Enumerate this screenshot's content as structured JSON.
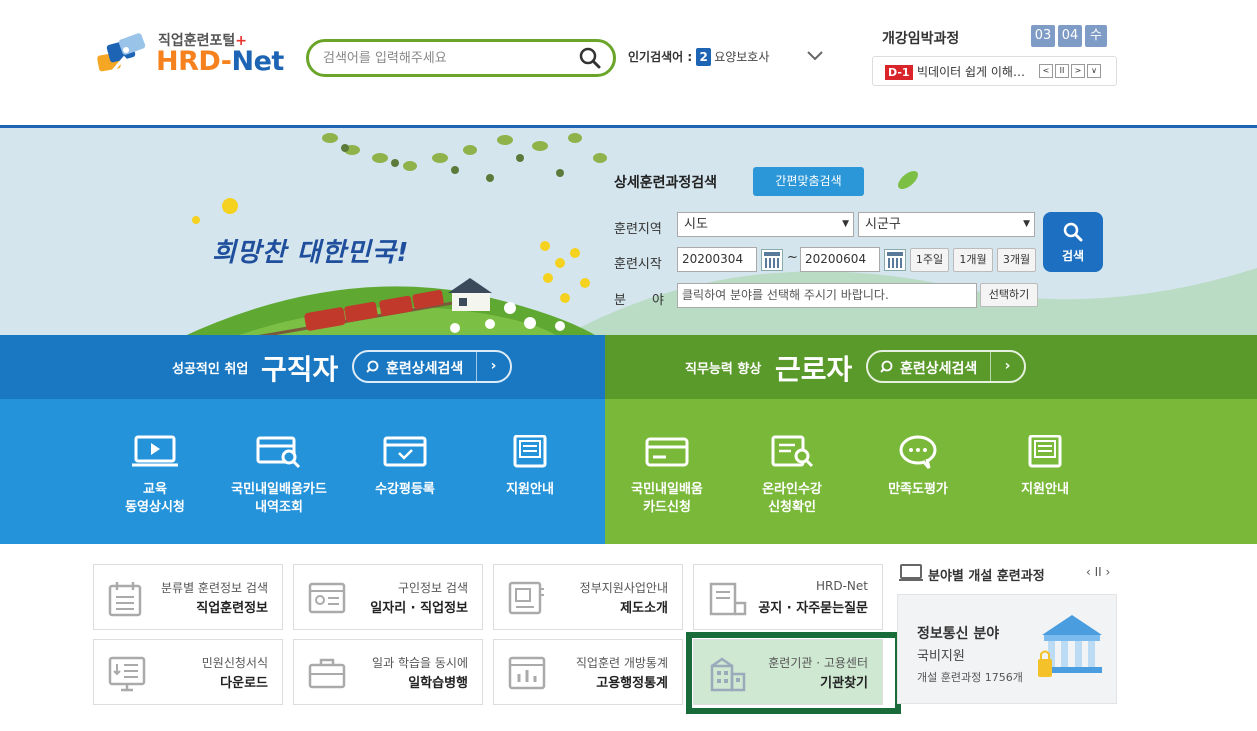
{
  "header": {
    "logo_small": "직업훈련포털",
    "logo_plus": "+",
    "logo_hrd": "HRD-",
    "logo_net": "Net",
    "search_placeholder": "검색어를 입력해주세요",
    "popular_label": "인기검색어 :",
    "popular_rank": "2",
    "popular_term": "요양보호사",
    "imminent_title": "개강임박과정",
    "date_month": "03",
    "date_day": "04",
    "date_weekday": "수",
    "dday": "D-1",
    "imminent_course": "빅데이터 쉽게 이해하기",
    "ctrl_prev": "<",
    "ctrl_pause": "II",
    "ctrl_next": ">",
    "ctrl_down": "∨"
  },
  "banner": {
    "slogan": "희망찬 대한민국!",
    "detail_title": "상세훈련과정검색",
    "simple_search": "간편맞춤검색",
    "label_region": "훈련지역",
    "select_sido": "시도",
    "select_sigungu": "시군구",
    "label_start": "훈련시작",
    "start_date": "20200304",
    "tilde": "~",
    "end_date": "20200604",
    "btn_1week": "1주일",
    "btn_1month": "1개월",
    "btn_3month": "3개월",
    "label_field_1": "분",
    "label_field_2": "야",
    "field_placeholder": "클릭하여 분야를 선택해 주시기 바랍니다.",
    "select_btn": "선택하기",
    "search_btn": "검색"
  },
  "jobseeker": {
    "sub": "성공적인 취업",
    "main": "구직자",
    "detail_search": "훈련상세검색",
    "items": [
      {
        "line1": "교육",
        "line2": "동영상시청"
      },
      {
        "line1": "국민내일배움카드",
        "line2": "내역조회"
      },
      {
        "line1": "수강평등록",
        "line2": ""
      },
      {
        "line1": "지원안내",
        "line2": ""
      }
    ]
  },
  "worker": {
    "sub": "직무능력 향상",
    "main": "근로자",
    "detail_search": "훈련상세검색",
    "items": [
      {
        "line1": "국민내일배움",
        "line2": "카드신청"
      },
      {
        "line1": "온라인수강",
        "line2": "신청확인"
      },
      {
        "line1": "만족도평가",
        "line2": ""
      },
      {
        "line1": "지원안내",
        "line2": ""
      }
    ]
  },
  "tiles": [
    {
      "sub": "분류별 훈련정보 검색",
      "main": "직업훈련정보"
    },
    {
      "sub": "구인정보 검색",
      "main": "일자리 · 직업정보"
    },
    {
      "sub": "정부지원사업안내",
      "main": "제도소개"
    },
    {
      "sub": "HRD-Net",
      "main": "공지 · 자주묻는질문"
    },
    {
      "sub": "민원신청서식",
      "main": "다운로드"
    },
    {
      "sub": "일과 학습을 동시에",
      "main": "일학습병행"
    },
    {
      "sub": "직업훈련 개방통계",
      "main": "고용행정통계"
    },
    {
      "sub": "훈련기관 · 고용센터",
      "main": "기관찾기"
    }
  ],
  "field_courses": {
    "title": "분야별 개설 훈련과정",
    "ctrl": "‹ II ›",
    "card_title": "정보통신 분야",
    "card_sub": "국비지원",
    "card_count": "개설 훈련과정 1756개"
  },
  "colors": {
    "brand_blue": "#1d64b4",
    "brand_orange": "#f5821f",
    "jobseeker_blue": "#1a78c2",
    "worker_green": "#5a9a2a",
    "highlight_frame": "#1a6b3a"
  }
}
